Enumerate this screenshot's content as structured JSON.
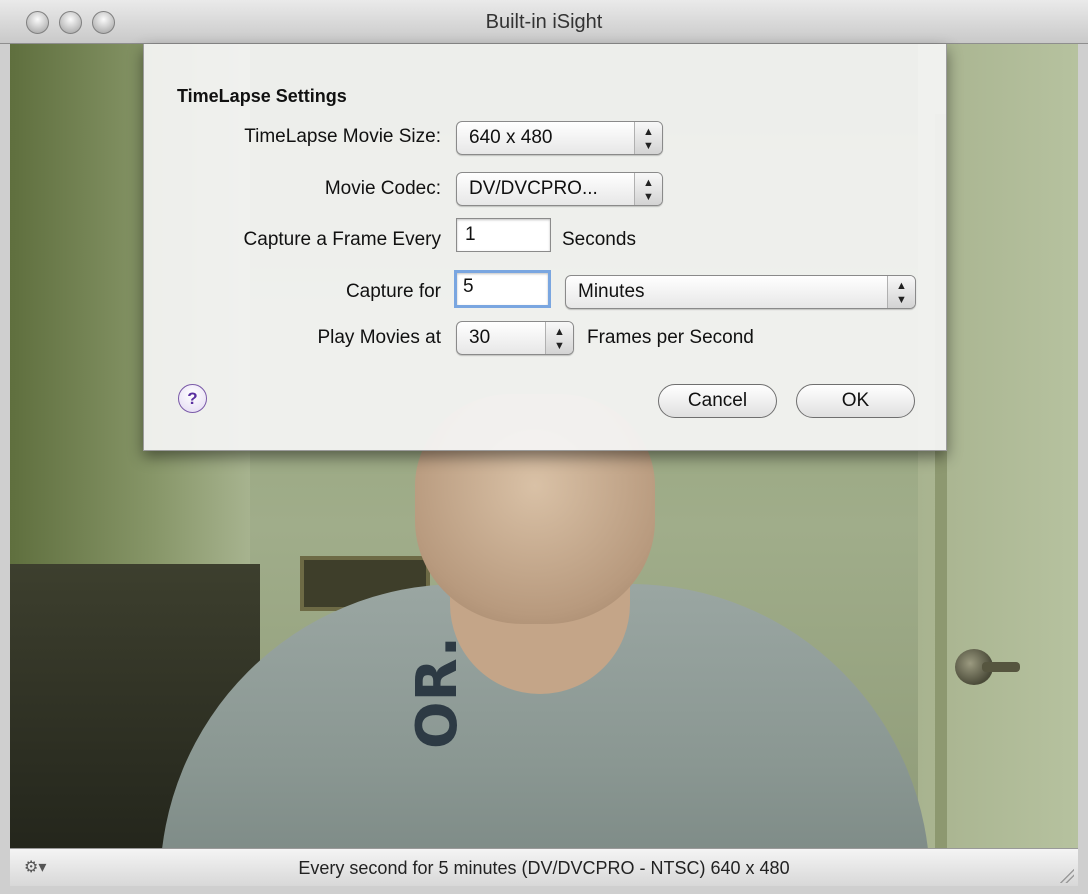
{
  "window": {
    "title": "Built-in iSight"
  },
  "sheet": {
    "heading": "TimeLapse Settings",
    "movie_size": {
      "label": "TimeLapse Movie Size:",
      "value": "640 x 480"
    },
    "codec": {
      "label": "Movie Codec:",
      "value": "DV/DVCPRO..."
    },
    "capture_every": {
      "label": "Capture a Frame Every",
      "value": "1",
      "unit": "Seconds"
    },
    "capture_for": {
      "label": "Capture for",
      "value": "5",
      "unit": "Minutes"
    },
    "play_at": {
      "label": "Play Movies at",
      "value": "30",
      "unit": "Frames per Second"
    },
    "help_symbol": "?",
    "cancel_label": "Cancel",
    "ok_label": "OK"
  },
  "camera": {
    "shirt_text": "OR."
  },
  "status": {
    "text": "Every second for 5 minutes (DV/DVCPRO - NTSC) 640 x 480",
    "gear_symbol": "⚙▾"
  },
  "icons": {
    "popup_arrows": "▲▼",
    "gear": "gear-icon",
    "help": "help-icon"
  }
}
